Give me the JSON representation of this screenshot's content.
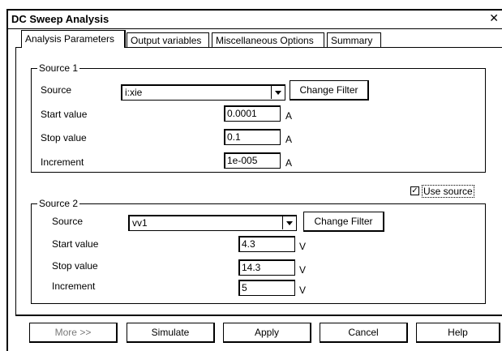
{
  "window": {
    "title": "DC Sweep Analysis",
    "close_glyph": "✕"
  },
  "tabs": [
    {
      "label": "Analysis Parameters",
      "active": true
    },
    {
      "label": "Output variables",
      "active": false
    },
    {
      "label": "Miscellaneous Options",
      "active": false
    },
    {
      "label": "Summary",
      "active": false
    }
  ],
  "source1": {
    "legend": "Source 1",
    "source_label": "Source",
    "source_value": "i:xie",
    "change_filter": "Change Filter",
    "start_label": "Start value",
    "start_value": "0.0001",
    "start_unit": "A",
    "stop_label": "Stop value",
    "stop_value": "0.1",
    "stop_unit": "A",
    "inc_label": "Increment",
    "inc_value": "1e-005",
    "inc_unit": "A"
  },
  "use_source": {
    "label": "Use source",
    "checked": true,
    "check_glyph": "✓"
  },
  "source2": {
    "legend": "Source 2",
    "source_label": "Source",
    "source_value": "vv1",
    "change_filter": "Change Filter",
    "start_label": "Start value",
    "start_value": "4.3",
    "start_unit": "V",
    "stop_label": "Stop value",
    "stop_value": "14.3",
    "stop_unit": "V",
    "inc_label": "Increment",
    "inc_value": "5",
    "inc_unit": "V"
  },
  "buttons": {
    "more": "More >>",
    "simulate": "Simulate",
    "apply": "Apply",
    "cancel": "Cancel",
    "help": "Help"
  }
}
